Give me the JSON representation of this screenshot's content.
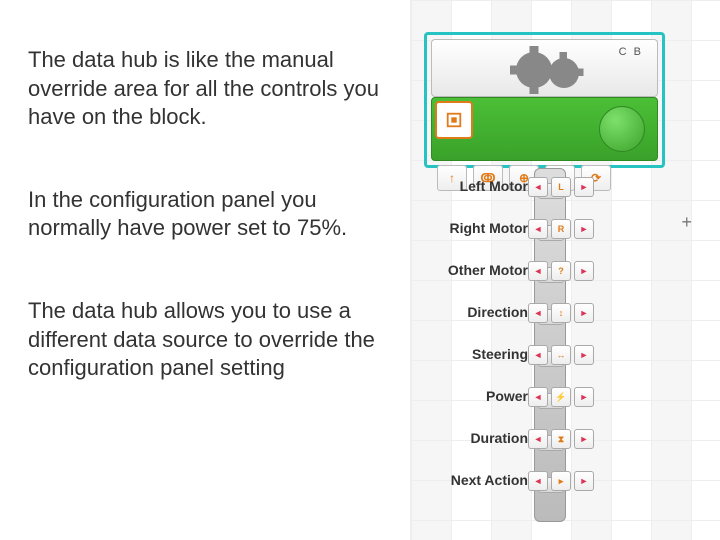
{
  "paragraphs": {
    "p1": "The data hub is like the manual override area for all the controls you have on the block.",
    "p2": "In the configuration panel you normally have power set to 75%.",
    "p3": "The data hub allows you to use a different data source to override the configuration panel  setting"
  },
  "block": {
    "ports_label": "C B"
  },
  "hub_rows": [
    {
      "label": "Left Motor",
      "glyph": "L"
    },
    {
      "label": "Right  Motor",
      "glyph": "R"
    },
    {
      "label": "Other Motor",
      "glyph": "?"
    },
    {
      "label": "Direction",
      "glyph": "↕"
    },
    {
      "label": "Steering",
      "glyph": "↔"
    },
    {
      "label": "Power",
      "glyph": "⚡"
    },
    {
      "label": "Duration",
      "glyph": "⧗"
    },
    {
      "label": "Next Action",
      "glyph": "▸"
    }
  ],
  "under_icons": [
    "↑",
    "ↂ",
    "⊕",
    "∞",
    "⟳"
  ]
}
